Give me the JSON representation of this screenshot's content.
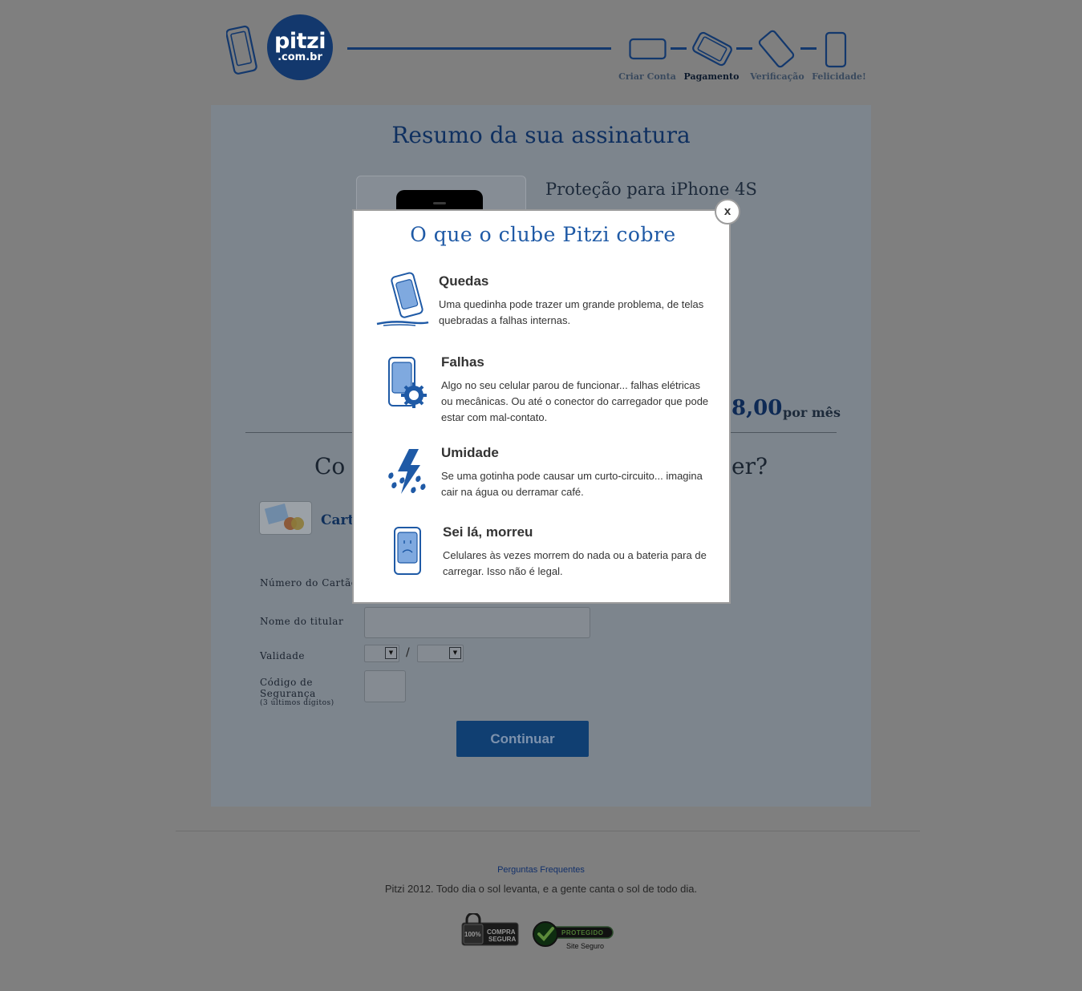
{
  "colors": {
    "brand_navy": "#13386d",
    "brand_blue": "#1f5aa6",
    "overlay": "#7f7f7f",
    "modal_bg": "#ffffff"
  },
  "header": {
    "logo": {
      "main": "pitzi",
      "sub": ".com.br"
    },
    "steps": [
      {
        "label": "Criar Conta",
        "icon": "phone-landscape-icon",
        "active": false
      },
      {
        "label": "Pagamento",
        "icon": "phone-tilted-landscape-icon",
        "active": true
      },
      {
        "label": "Verificação",
        "icon": "phone-tilted-icon",
        "active": false
      },
      {
        "label": "Felicidade!",
        "icon": "phone-portrait-icon",
        "active": false
      }
    ]
  },
  "summary": {
    "title": "Resumo da sua assinatura",
    "product_name": "Proteção para iPhone 4S",
    "price_visible": "8,00",
    "price_suffix": "por mês"
  },
  "payment": {
    "question_left": "Co",
    "question_right": "er?",
    "card_label": "Cart",
    "card_logo": "visa-mastercard-icon",
    "fields": {
      "card_number_label": "Número do Cartão",
      "holder_label": "Nome do titular",
      "validity_label": "Validade",
      "validity_separator": "/",
      "security_label_1": "Código de",
      "security_label_2": "Segurança",
      "security_hint": "(3 últimos dígitos)"
    },
    "continue_label": "Continuar"
  },
  "footer": {
    "faq_link": "Perguntas Frequentes",
    "tagline": "Pitzi 2012. Todo dia o sol levanta, e a gente canta o sol de todo dia.",
    "badge_secure_percent": "100%",
    "badge_secure_line1": "COMPRA",
    "badge_secure_line2": "SEGURA",
    "badge_protected_title": "PROTEGIDO",
    "badge_protected_sub": "Site Seguro"
  },
  "modal": {
    "close_label": "x",
    "title": "O que o clube Pitzi cobre",
    "items": [
      {
        "icon": "falling-phone-icon",
        "title": "Quedas",
        "desc": "Uma quedinha pode trazer um grande problema, de telas quebradas a falhas internas."
      },
      {
        "icon": "phone-gear-icon",
        "title": "Falhas",
        "desc": "Algo no seu celular parou de funcionar... falhas elétricas ou mecânicas. Ou até o conector do carregador que pode estar com mal-contato."
      },
      {
        "icon": "rain-lightning-icon",
        "title": "Umidade",
        "desc": "Se uma gotinha pode causar um curto-circuito... imagina cair na água ou derramar café."
      },
      {
        "icon": "sad-phone-icon",
        "title": "Sei lá, morreu",
        "desc": "Celulares às vezes morrem do nada ou a bateria para de carregar. Isso não é legal."
      }
    ]
  }
}
